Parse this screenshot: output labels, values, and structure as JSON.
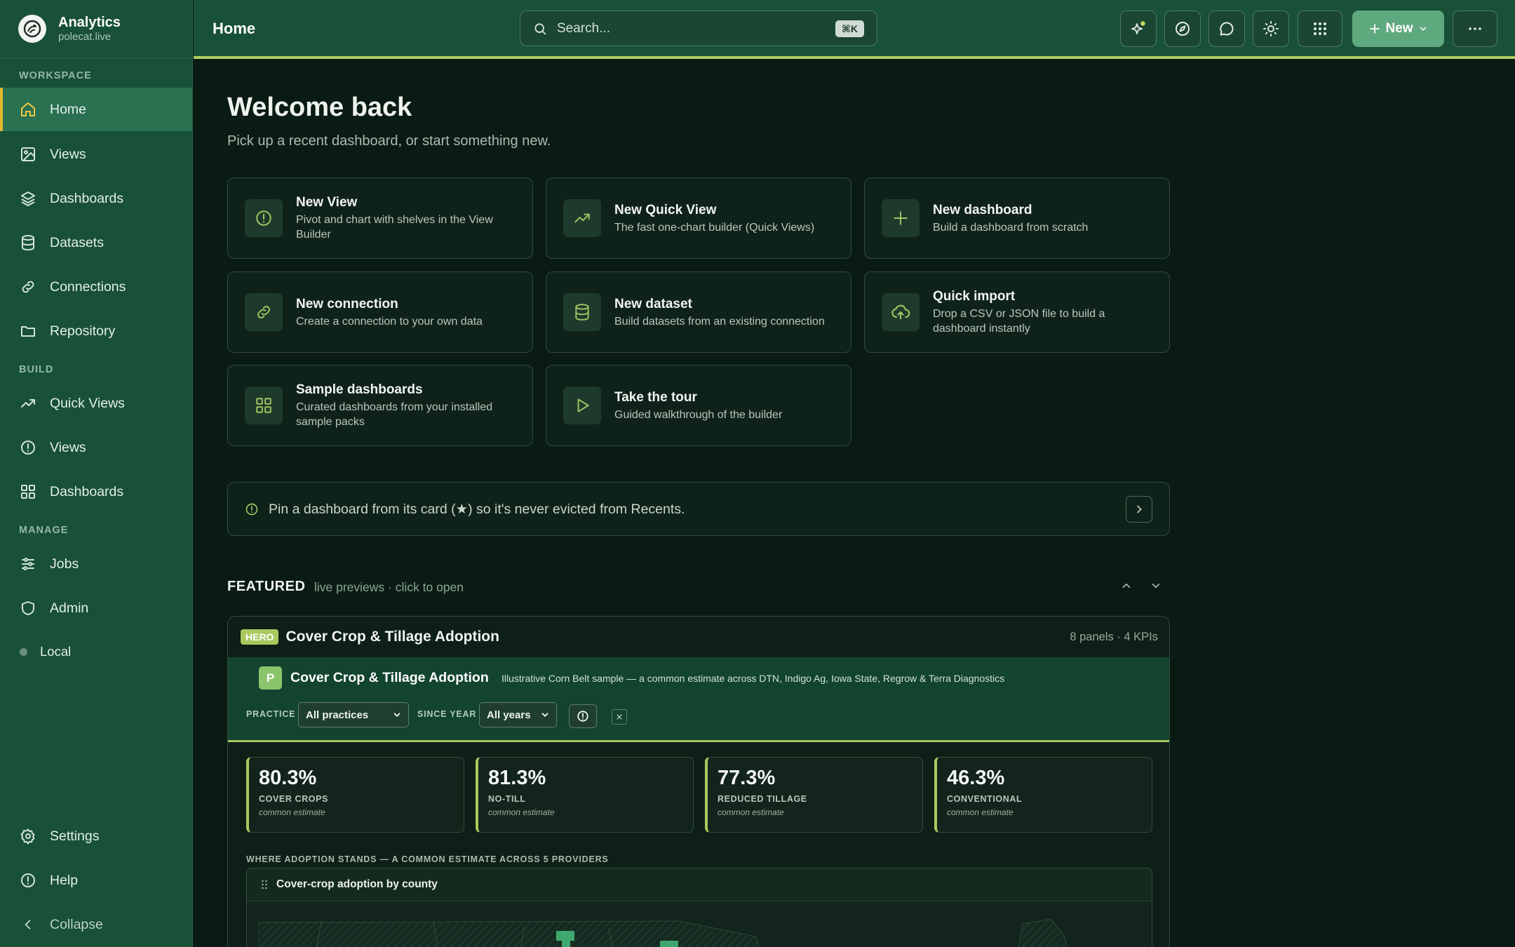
{
  "brand": {
    "title": "Analytics",
    "subtitle": "polecat.live"
  },
  "sidebar": {
    "sections": [
      {
        "label": "WORKSPACE"
      },
      {
        "label": "BUILD"
      },
      {
        "label": "MANAGE"
      }
    ],
    "workspace": [
      {
        "label": "Home",
        "icon": "home-icon",
        "active": true
      },
      {
        "label": "Views",
        "icon": "image-icon"
      },
      {
        "label": "Dashboards",
        "icon": "layers-icon"
      },
      {
        "label": "Datasets",
        "icon": "database-icon"
      },
      {
        "label": "Connections",
        "icon": "link-icon"
      },
      {
        "label": "Repository",
        "icon": "folder-icon"
      }
    ],
    "build": [
      {
        "label": "Quick Views",
        "icon": "trend-icon"
      },
      {
        "label": "Views",
        "icon": "info-circle-icon"
      },
      {
        "label": "Dashboards",
        "icon": "grid-icon"
      }
    ],
    "manage": [
      {
        "label": "Jobs",
        "icon": "sliders-icon"
      },
      {
        "label": "Admin",
        "icon": "shield-icon"
      },
      {
        "label": "Local",
        "icon": "status-dot"
      }
    ],
    "footer": [
      {
        "label": "Settings",
        "icon": "gear-icon"
      },
      {
        "label": "Help",
        "icon": "help-icon"
      },
      {
        "label": "Collapse",
        "icon": "chevron-left-icon"
      }
    ]
  },
  "topbar": {
    "title": "Home",
    "search_placeholder": "Search...",
    "search_shortcut": "⌘K",
    "new_label": "New"
  },
  "main": {
    "welcome": "Welcome back",
    "subtitle": "Pick up a recent dashboard, or start something new.",
    "cards": [
      {
        "title": "New View",
        "desc": "Pivot and chart with shelves in the View Builder",
        "icon": "info-circle-icon"
      },
      {
        "title": "New Quick View",
        "desc": "The fast one-chart builder (Quick Views)",
        "icon": "trend-icon"
      },
      {
        "title": "New dashboard",
        "desc": "Build a dashboard from scratch",
        "icon": "plus-icon"
      },
      {
        "title": "New connection",
        "desc": "Create a connection to your own data",
        "icon": "link-icon"
      },
      {
        "title": "New dataset",
        "desc": "Build datasets from an existing connection",
        "icon": "database-icon"
      },
      {
        "title": "Quick import",
        "desc": "Drop a CSV or JSON file to build a dashboard instantly",
        "icon": "upload-cloud-icon"
      },
      {
        "title": "Sample dashboards",
        "desc": "Curated dashboards from your installed sample packs",
        "icon": "grid-icon"
      },
      {
        "title": "Take the tour",
        "desc": "Guided walkthrough of the builder",
        "icon": "play-icon"
      }
    ],
    "tip": "Pin a dashboard from its card (★) so it's never evicted from Recents.",
    "featured": {
      "title": "FEATURED",
      "subtitle": "live previews · click to open",
      "badge": "HERO",
      "name": "Cover Crop & Tillage Adoption",
      "meta": "8 panels · 4 KPIs",
      "dashboard": {
        "logo_letter": "P",
        "title": "Cover Crop & Tillage Adoption",
        "description": "Illustrative Corn Belt sample — a common estimate across DTN, Indigo Ag, Iowa State, Regrow & Terra Diagnostics",
        "filters": [
          {
            "label": "PRACTICE",
            "value": "All practices"
          },
          {
            "label": "SINCE YEAR",
            "value": "All years"
          }
        ],
        "kpis": [
          {
            "value": "80.3%",
            "label": "COVER CROPS",
            "sub": "common estimate"
          },
          {
            "value": "81.3%",
            "label": "NO-TILL",
            "sub": "common estimate"
          },
          {
            "value": "77.3%",
            "label": "REDUCED TILLAGE",
            "sub": "common estimate"
          },
          {
            "value": "46.3%",
            "label": "CONVENTIONAL",
            "sub": "common estimate"
          }
        ],
        "section_label": "WHERE ADOPTION STANDS — A COMMON ESTIMATE ACROSS 5 PROVIDERS",
        "panel_title": "Cover-crop adoption by county"
      }
    }
  },
  "colors": {
    "accent": "#a9c95e",
    "sidebar": "#185038",
    "active_marker": "#e6b830",
    "primary_button": "#5fa97f"
  }
}
